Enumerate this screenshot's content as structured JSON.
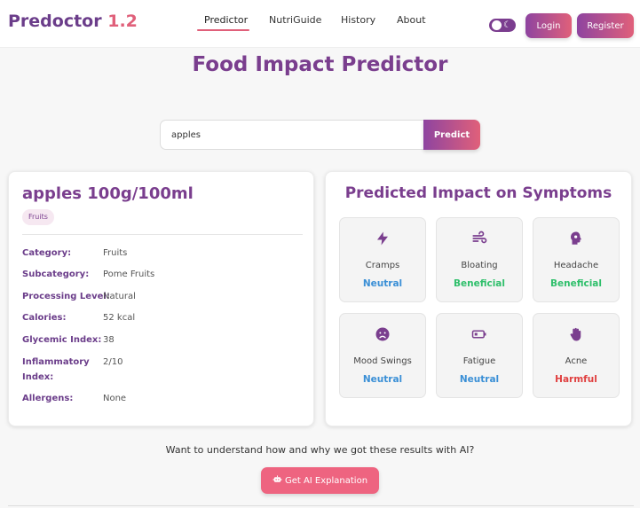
{
  "brand": {
    "name": "Predoctor",
    "version": "1.2"
  },
  "nav": {
    "links": [
      "Predictor",
      "NutriGuide",
      "History",
      "About"
    ],
    "login_label": "Login",
    "register_label": "Register"
  },
  "page_title": "Food Impact Predictor",
  "search": {
    "value": "apples",
    "button_label": "Predict"
  },
  "food": {
    "title": "apples 100g/100ml",
    "tag": "Fruits",
    "details": [
      {
        "label": "Category:",
        "value": "Fruits"
      },
      {
        "label": "Subcategory:",
        "value": "Pome Fruits"
      },
      {
        "label": "Processing Level:",
        "value": "Natural"
      },
      {
        "label": "Calories:",
        "value": "52 kcal"
      },
      {
        "label": "Glycemic Index:",
        "value": "38"
      },
      {
        "label": "Inflammatory Index:",
        "value": "2/10"
      },
      {
        "label": "Allergens:",
        "value": "None"
      }
    ]
  },
  "impact": {
    "title": "Predicted Impact on Symptoms",
    "symptoms": [
      {
        "icon": "lightning-icon",
        "name": "Cramps",
        "result": "Neutral",
        "color": "#3a8fd6"
      },
      {
        "icon": "wind-icon",
        "name": "Bloating",
        "result": "Beneficial",
        "color": "#2fbf6b"
      },
      {
        "icon": "head-icon",
        "name": "Headache",
        "result": "Beneficial",
        "color": "#2fbf6b"
      },
      {
        "icon": "sad-face-icon",
        "name": "Mood Swings",
        "result": "Neutral",
        "color": "#3a8fd6"
      },
      {
        "icon": "battery-low-icon",
        "name": "Fatigue",
        "result": "Neutral",
        "color": "#3a8fd6"
      },
      {
        "icon": "hand-icon",
        "name": "Acne",
        "result": "Harmful",
        "color": "#e04040"
      }
    ]
  },
  "ai": {
    "question": "Want to understand how and why we got these results with AI?",
    "button_label": "Get AI Explanation"
  },
  "colors": {
    "primary": "#7a3e8e",
    "accent": "#e0607a"
  }
}
